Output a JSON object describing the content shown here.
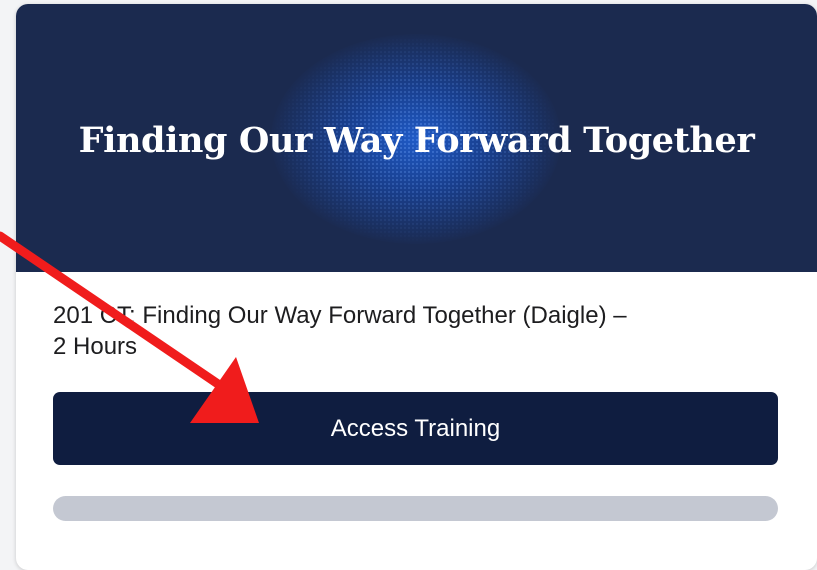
{
  "card": {
    "banner_title": "Finding Our Way Forward Together",
    "course_title_line1": "201 CT: Finding Our Way Forward Together (Daigle) –",
    "course_title_line2": "2 Hours",
    "access_button_label": "Access Training",
    "progress_fraction": 0
  },
  "colors": {
    "banner": "#1b2a4f",
    "button": "#0f1d40",
    "progress_track": "#c4c8d2",
    "annotation_arrow": "#f01c1c"
  },
  "annotation": {
    "icon": "red-arrow-icon"
  }
}
